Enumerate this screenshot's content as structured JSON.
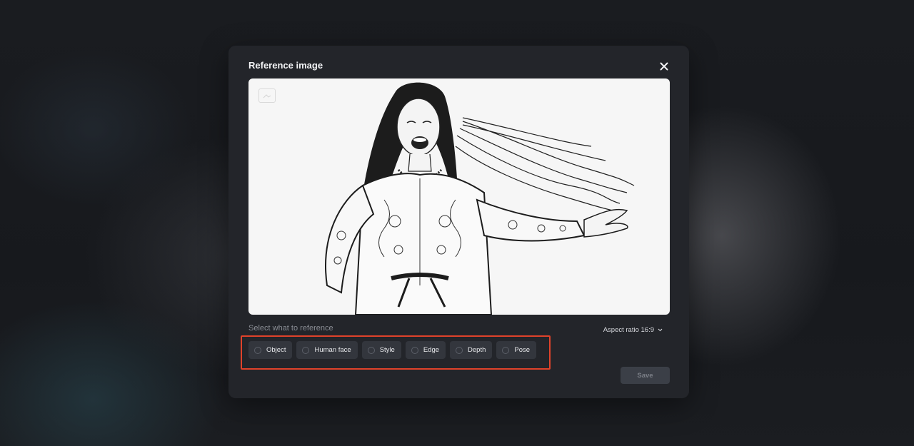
{
  "dialog": {
    "title": "Reference image",
    "close_icon": "close-icon"
  },
  "reference": {
    "select_label": "Select what to reference",
    "aspect_ratio_label": "Aspect ratio 16:9",
    "options": [
      {
        "label": "Object",
        "selected": false
      },
      {
        "label": "Human face",
        "selected": false
      },
      {
        "label": "Style",
        "selected": false
      },
      {
        "label": "Edge",
        "selected": false
      },
      {
        "label": "Depth",
        "selected": false
      },
      {
        "label": "Pose",
        "selected": false
      }
    ]
  },
  "actions": {
    "save_label": "Save"
  },
  "colors": {
    "highlight": "#e0422a",
    "modal_bg": "#23252a",
    "chip_bg": "#33363d"
  }
}
